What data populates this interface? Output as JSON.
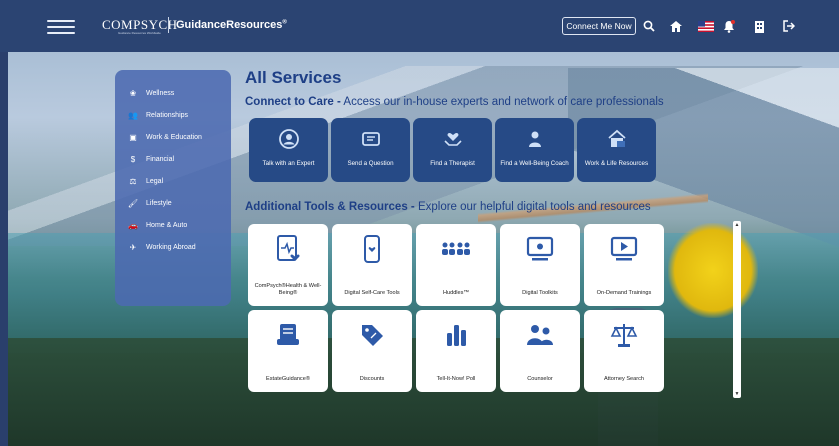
{
  "header": {
    "logo_text": "COMPSYCH",
    "logo_tagline": "Guidance Resources Worldwide",
    "product_name": "GuidanceResources",
    "product_mark": "®",
    "connect_label": "Connect Me Now"
  },
  "menu": [
    {
      "label": "Wellness",
      "icon": "lotus-icon"
    },
    {
      "label": "Relationships",
      "icon": "people-icon"
    },
    {
      "label": "Work & Education",
      "icon": "briefcase-icon"
    },
    {
      "label": "Financial",
      "icon": "money-icon"
    },
    {
      "label": "Legal",
      "icon": "gavel-icon"
    },
    {
      "label": "Lifestyle",
      "icon": "paint-roller-icon"
    },
    {
      "label": "Home & Auto",
      "icon": "car-icon"
    },
    {
      "label": "Working Abroad",
      "icon": "airplane-icon"
    }
  ],
  "page": {
    "title": "All Services",
    "care_heading_bold": "Connect to Care -",
    "care_heading_rest": " Access our in-house experts and network of care professionals",
    "tools_heading_bold": "Additional Tools & Resources -",
    "tools_heading_rest": " Explore our helpful digital tools and resources"
  },
  "care_tiles": [
    {
      "label": "Talk with an Expert",
      "icon": "person-circle-icon"
    },
    {
      "label": "Send a Question",
      "icon": "envelope-icon"
    },
    {
      "label": "Find a Therapist",
      "icon": "heart-hands-icon"
    },
    {
      "label": "Find a Well-Being Coach",
      "icon": "coach-icon"
    },
    {
      "label": "Work & Life Resources",
      "icon": "house-briefcase-icon"
    }
  ],
  "tools": [
    {
      "label": "ComPsych®Health & Well-Being®",
      "icon": "heart-tablet-icon"
    },
    {
      "label": "Digital Self-Care Tools",
      "icon": "phone-icon"
    },
    {
      "label": "Huddles™",
      "icon": "group-icon"
    },
    {
      "label": "Digital Toolkits",
      "icon": "monitor-icon"
    },
    {
      "label": "On-Demand Trainings",
      "icon": "play-screen-icon"
    },
    {
      "label": "EstateGuidance®",
      "icon": "document-stack-icon"
    },
    {
      "label": "Discounts",
      "icon": "tag-icon"
    },
    {
      "label": "Tell-It-Now! Poll",
      "icon": "bar-chart-icon"
    },
    {
      "label": "Counselor",
      "icon": "counselor-icon"
    },
    {
      "label": "Attorney Search",
      "icon": "scales-icon"
    }
  ],
  "colors": {
    "brand_navy": "#2b4472",
    "heading_blue": "#1e3f86",
    "tile_blue": "#264a86",
    "menu_blue": "#4c6ab0",
    "icon_blue": "#2e5aa8"
  }
}
